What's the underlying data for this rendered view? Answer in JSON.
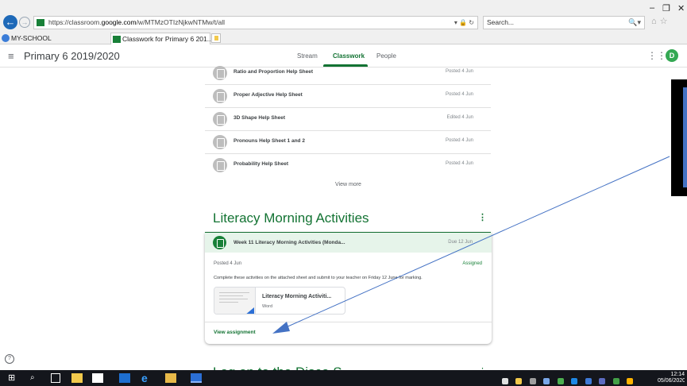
{
  "browser": {
    "url_prefix": "https://classroom.",
    "url_domain": "google.com",
    "url_suffix": "/w/MTMzOTIzNjkwNTMw/t/all",
    "addr_tools": "▾ 🔒 ↻",
    "search_placeholder": "Search...",
    "search_go": "🔍▾",
    "tabs": [
      {
        "label": "MY-SCHOOL"
      },
      {
        "label": "Classwork for Primary 6 201..."
      }
    ]
  },
  "classroom": {
    "class_name": "Primary 6 2019/2020",
    "tabs": [
      "Stream",
      "Classwork",
      "People"
    ],
    "active_tab": "Classwork",
    "avatar_letter": "D"
  },
  "materials": [
    {
      "title": "Ratio and Proportion Help Sheet",
      "date": "Posted 4 Jun"
    },
    {
      "title": "Proper Adjective Help Sheet",
      "date": "Posted 4 Jun"
    },
    {
      "title": "3D Shape Help Sheet",
      "date": "Edited 4 Jun"
    },
    {
      "title": "Pronouns Help Sheet 1 and 2",
      "date": "Posted 4 Jun"
    },
    {
      "title": "Probability Help Sheet",
      "date": "Posted 4 Jun"
    }
  ],
  "view_more": "View more",
  "topic": {
    "title": "Literacy Morning Activities",
    "assignment": {
      "title": "Week 11 Literacy Morning Activities (Monda...",
      "due": "Due 12 Jun",
      "posted": "Posted 4 Jun",
      "status": "Assigned",
      "instructions": "Complete these activities on the attached sheet and submit to your teacher on Friday 12 June for marking.",
      "attachment_name": "Literacy Morning Activiti...",
      "attachment_type": "Word",
      "view_label": "View assignment"
    }
  },
  "next_topic": {
    "title": "Log on to the Disco S..."
  },
  "taskbar": {
    "clock_time": "12:14",
    "clock_date": "05/06/2020"
  },
  "colors": {
    "classroom_green": "#137333",
    "assignment_icon": "#188038",
    "annotation_blue": "#4472c4"
  }
}
